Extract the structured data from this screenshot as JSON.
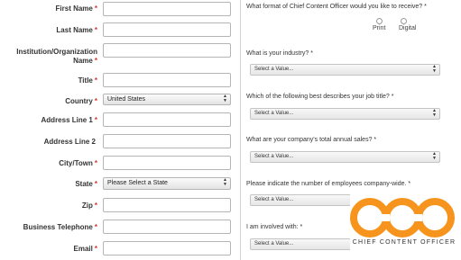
{
  "left_form": {
    "fields": [
      {
        "label": "First Name",
        "required": "*",
        "type": "input",
        "value": ""
      },
      {
        "label": "Last Name",
        "required": "*",
        "type": "input",
        "value": ""
      },
      {
        "label": "Institution/Organization Name",
        "required": "*",
        "type": "input",
        "value": ""
      },
      {
        "label": "Title",
        "required": "*",
        "type": "input",
        "value": ""
      },
      {
        "label": "Country",
        "required": "*",
        "type": "select",
        "value": "United States"
      },
      {
        "label": "Address Line 1",
        "required": "*",
        "type": "input",
        "value": ""
      },
      {
        "label": "Address Line 2",
        "required": "",
        "type": "input",
        "value": ""
      },
      {
        "label": "City/Town",
        "required": "*",
        "type": "input",
        "value": ""
      },
      {
        "label": "State",
        "required": "*",
        "type": "select",
        "value": "Please Select a State"
      },
      {
        "label": "Zip",
        "required": "*",
        "type": "input",
        "value": ""
      },
      {
        "label": "Business Telephone",
        "required": "*",
        "type": "input",
        "value": ""
      },
      {
        "label": "Email",
        "required": "*",
        "type": "input",
        "value": ""
      }
    ]
  },
  "right_form": {
    "format_question": "What format of Chief Content Officer would you like to receive? *",
    "format_options": [
      "Print",
      "Digital"
    ],
    "questions": [
      {
        "question": "What is your industry? *",
        "value": "Select a Value..."
      },
      {
        "question": "Which of the following best describes your job title? *",
        "value": "Select a Value..."
      },
      {
        "question": "What are your company's total annual sales? *",
        "value": "Select a Value..."
      },
      {
        "question": "Please indicate the number of employees company-wide. *",
        "value": "Select a Value..."
      },
      {
        "question": "I am involved with: *",
        "value": "Select a Value..."
      }
    ]
  },
  "logo": {
    "text": "CHIEF CONTENT OFFICER",
    "color": "#f7941d"
  }
}
